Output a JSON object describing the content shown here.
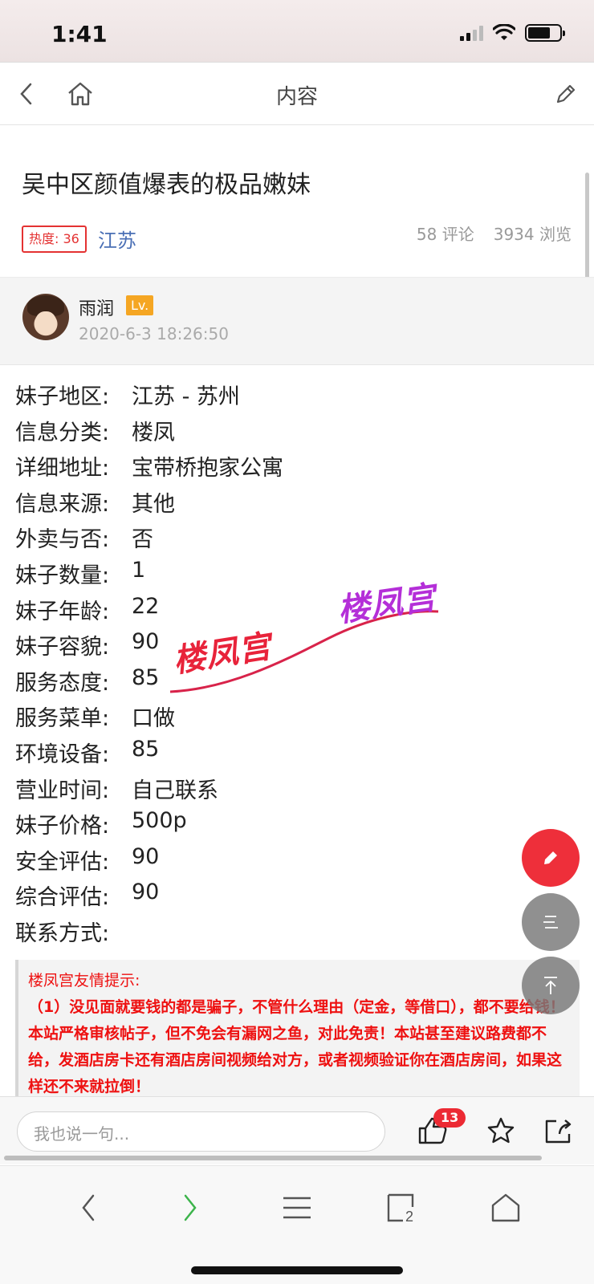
{
  "status_bar": {
    "time": "1:41"
  },
  "nav": {
    "title": "内容"
  },
  "post": {
    "title": "吴中区颜值爆表的极品嫩妹",
    "heat_label": "热度: 36",
    "region": "江苏",
    "comments": "58 评论",
    "views": "3934 浏览"
  },
  "author": {
    "name": "雨润",
    "level": "Lv.",
    "date": "2020-6-3 18:26:50"
  },
  "info": [
    {
      "key": "妹子地区:",
      "value": "江苏 - 苏州"
    },
    {
      "key": "信息分类:",
      "value": "楼凤"
    },
    {
      "key": "详细地址:",
      "value": "宝带桥抱家公寓"
    },
    {
      "key": "信息来源:",
      "value": "其他"
    },
    {
      "key": "外卖与否:",
      "value": "否"
    },
    {
      "key": "妹子数量:",
      "value": "1"
    },
    {
      "key": "妹子年龄:",
      "value": "22"
    },
    {
      "key": "妹子容貌:",
      "value": "90"
    },
    {
      "key": "服务态度:",
      "value": "85"
    },
    {
      "key": "服务菜单:",
      "value": "口做"
    },
    {
      "key": "环境设备:",
      "value": "85"
    },
    {
      "key": "营业时间:",
      "value": "自己联系"
    },
    {
      "key": "妹子价格:",
      "value": "500p"
    },
    {
      "key": "安全评估:",
      "value": "90"
    },
    {
      "key": "综合评估:",
      "value": "90"
    },
    {
      "key": "联系方式:",
      "value": ""
    }
  ],
  "watermark": {
    "left": "楼凤宫",
    "right": "楼凤宫"
  },
  "notice": {
    "title": "楼凤宫友情提示:",
    "body": "（1）没见面就要钱的都是骗子，不管什么理由（定金，等借口），都不要给钱！本站严格审核帖子，但不免会有漏网之鱼，对此免责！本站甚至建议路费都不给，发酒店房卡还有酒店房间视频给对方，或者视频验证你在酒店房间，如果这样还不来就拉倒！"
  },
  "comment_bar": {
    "placeholder": "我也说一句...",
    "like_count": "13"
  },
  "toolbar": {
    "tabs_count": "2"
  },
  "colors": {
    "accent_red": "#ee2f3a",
    "link_blue": "#4a6fb5",
    "level_orange": "#f5a623",
    "forward_green": "#3cb44b"
  }
}
